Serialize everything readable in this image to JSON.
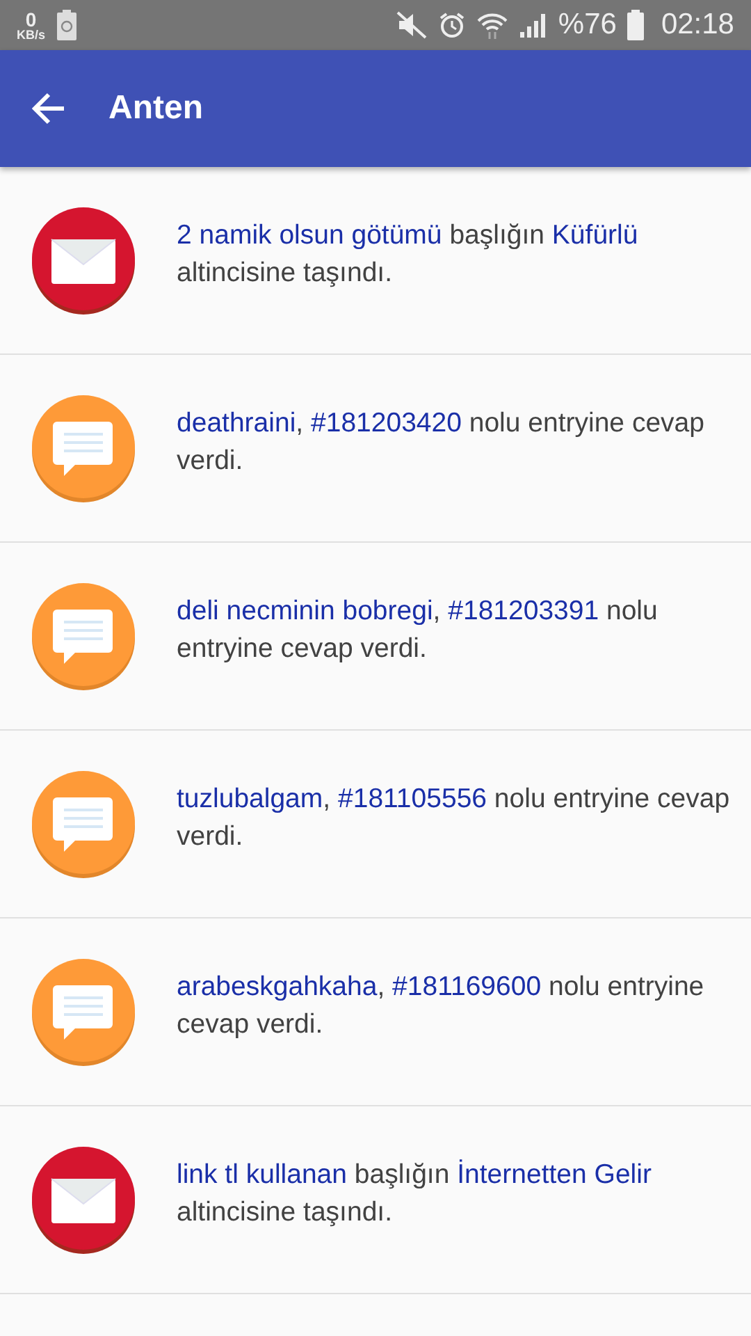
{
  "status_bar": {
    "speed_value": "0",
    "speed_unit": "KB/s",
    "battery": "%76",
    "time": "02:18"
  },
  "app_bar": {
    "title": "Anten"
  },
  "notifications": [
    {
      "kind": "moved",
      "parts": [
        {
          "kind": "link",
          "text": "2 namik olsun götümü"
        },
        {
          "kind": "plain",
          "text": " başlığın "
        },
        {
          "kind": "link",
          "text": "Küfürlü"
        },
        {
          "kind": "plain",
          "text": " altincisine taşındı."
        }
      ]
    },
    {
      "kind": "reply",
      "parts": [
        {
          "kind": "link",
          "text": "deathraini"
        },
        {
          "kind": "plain",
          "text": ", "
        },
        {
          "kind": "link",
          "text": "#181203420"
        },
        {
          "kind": "plain",
          "text": " nolu entryine cevap verdi."
        }
      ]
    },
    {
      "kind": "reply",
      "parts": [
        {
          "kind": "link",
          "text": "deli necminin bobregi"
        },
        {
          "kind": "plain",
          "text": ", "
        },
        {
          "kind": "link",
          "text": "#181203391"
        },
        {
          "kind": "plain",
          "text": " nolu entryine cevap verdi."
        }
      ]
    },
    {
      "kind": "reply",
      "parts": [
        {
          "kind": "link",
          "text": "tuzlubalgam"
        },
        {
          "kind": "plain",
          "text": ", "
        },
        {
          "kind": "link",
          "text": "#181105556"
        },
        {
          "kind": "plain",
          "text": " nolu entryine cevap verdi."
        }
      ]
    },
    {
      "kind": "reply",
      "parts": [
        {
          "kind": "link",
          "text": "arabeskgahkaha"
        },
        {
          "kind": "plain",
          "text": ", "
        },
        {
          "kind": "link",
          "text": "#181169600"
        },
        {
          "kind": "plain",
          "text": " nolu entryine cevap verdi."
        }
      ]
    },
    {
      "kind": "moved",
      "parts": [
        {
          "kind": "link",
          "text": "link tl kullanan"
        },
        {
          "kind": "plain",
          "text": " başlığın "
        },
        {
          "kind": "link",
          "text": "İnternetten Gelir"
        },
        {
          "kind": "plain",
          "text": " altincisine taşındı."
        }
      ]
    }
  ]
}
